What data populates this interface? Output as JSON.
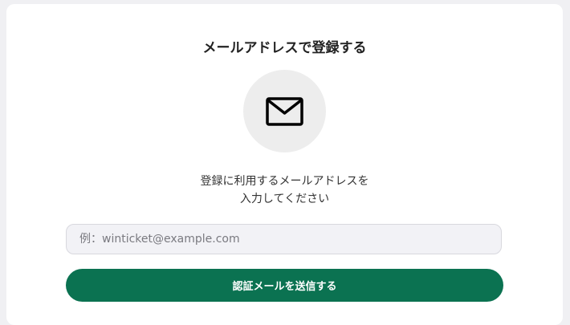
{
  "title": "メールアドレスで登録する",
  "icon": "mail-icon",
  "description": {
    "line1": "登録に利用するメールアドレスを",
    "line2": "入力してください"
  },
  "email_input": {
    "value": "",
    "placeholder": "例：winticket@example.com"
  },
  "send_button": {
    "label": "認証メールを送信する"
  },
  "colors": {
    "accent": "#0b7251",
    "background": "#f0f0f3",
    "card": "#ffffff",
    "icon_circle": "#ededed"
  }
}
